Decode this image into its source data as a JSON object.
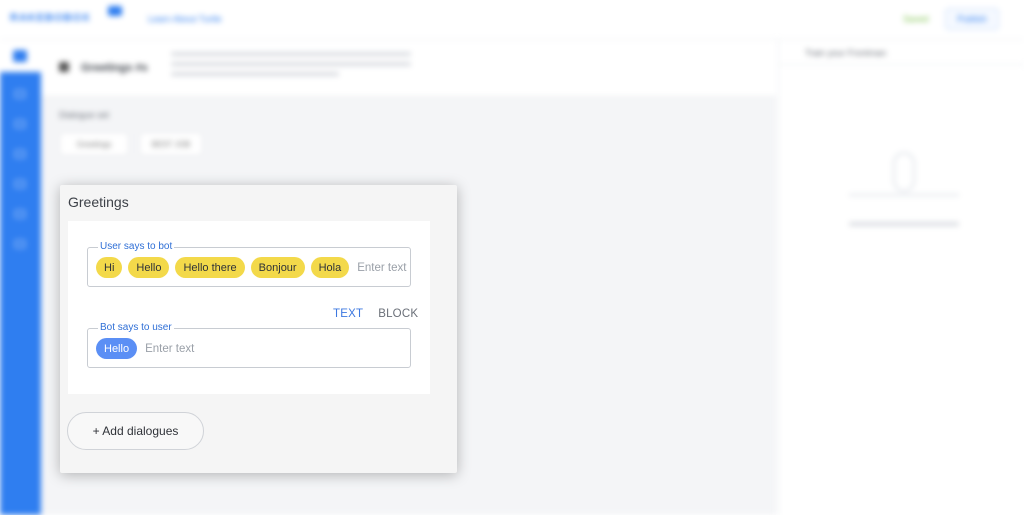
{
  "topbar": {
    "logo_text": "RAKEBOBOX",
    "project_name": "Learn About Turtle",
    "saved_status": "Saved",
    "publish_label": "Publish"
  },
  "intent_bar": {
    "title": "Greetings #s"
  },
  "dialogue_sets": {
    "label": "Dialogue set",
    "chips": [
      "Greetings",
      "BEST JOB"
    ]
  },
  "right_panel": {
    "title": "Train your Frontman"
  },
  "dialog": {
    "title": "Greetings",
    "user_field": {
      "legend": "User says to bot",
      "chips": [
        "Hi",
        "Hello",
        "Hello there",
        "Bonjour",
        "Hola"
      ],
      "placeholder": "Enter text"
    },
    "mode_tabs": {
      "text_label": "TEXT",
      "block_label": "BLOCK",
      "active": "TEXT"
    },
    "bot_field": {
      "legend": "Bot says to user",
      "chips": [
        "Hello"
      ],
      "placeholder": "Enter text"
    },
    "add_button_label": "+ Add dialogues"
  },
  "colors": {
    "accent": "#2f7ef0",
    "user_chip": "#f3d94a",
    "bot_chip": "#5b8ff5"
  }
}
